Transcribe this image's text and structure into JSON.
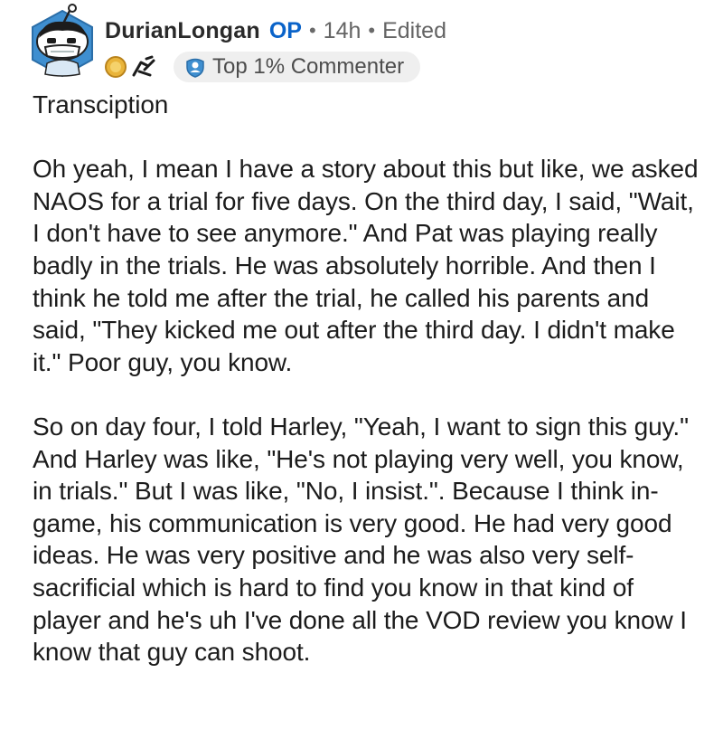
{
  "comment": {
    "author": "DurianLongan",
    "op_badge": "OP",
    "separator": "•",
    "time_ago": "14h",
    "edited_label": "Edited",
    "flair": {
      "icon": "shield-person-icon",
      "label": "Top 1% Commenter"
    },
    "award_icons": [
      "gold-coin-award-icon",
      "sport-figure-award-icon"
    ],
    "body": [
      "Transciption",
      "Oh yeah, I mean I have a story about this but like, we asked NAOS for a trial for five days. On the third day, I said, \"Wait, I don't have to see anymore.\" And Pat was playing really badly in the trials. He was absolutely horrible. And then I think he told me after the trial, he called his parents and said, \"They kicked me out after the third day. I didn't make it.\" Poor guy, you know.",
      "So on day four, I told Harley, \"Yeah, I want to sign this guy.\" And Harley was like, \"He's not playing very well, you know, in trials.\" But I was like, \"No, I insist.\". Because I think in-game, his communication is very good. He had very good ideas. He was very positive and he was also very self-sacrificial which is hard to find you know in that kind of player and he's uh I've done all the VOD review you know I know that guy can shoot."
    ]
  },
  "colors": {
    "op": "#0a63c9",
    "avatar_bg": "#3f8fd0",
    "flair_bg": "#efefef"
  }
}
